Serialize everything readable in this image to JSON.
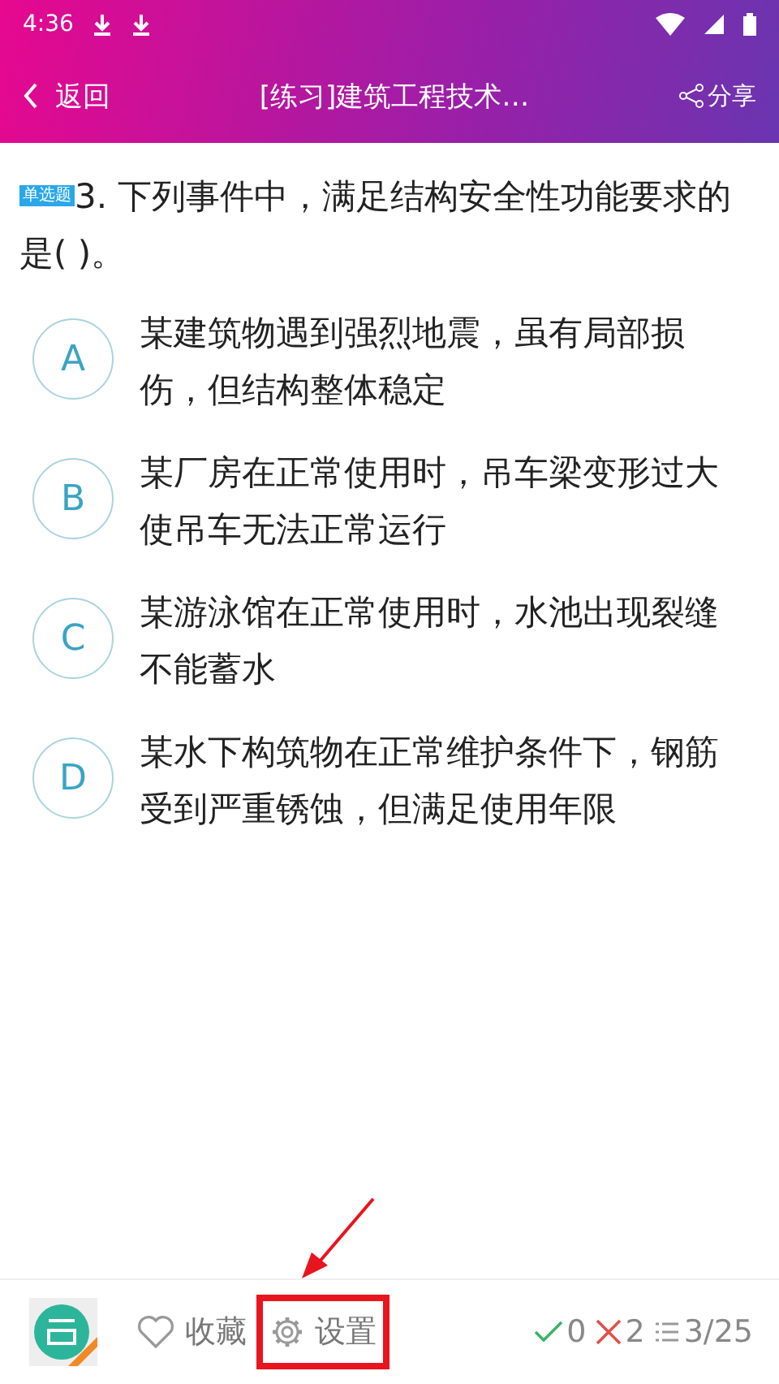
{
  "status_bar": {
    "time": "4:36"
  },
  "app_bar": {
    "back": "返回",
    "title": "[练习]建筑工程技术…",
    "share": "分享"
  },
  "question": {
    "type_badge": "单选题",
    "text": "3. 下列事件中，满足结构安全性功能要求的是( )。"
  },
  "options": [
    {
      "letter": "A",
      "text": "某建筑物遇到强烈地震，虽有局部损伤，但结构整体稳定"
    },
    {
      "letter": "B",
      "text": "某厂房在正常使用时，吊车梁变形过大使吊车无法正常运行"
    },
    {
      "letter": "C",
      "text": "某游泳馆在正常使用时，水池出现裂缝不能蓄水"
    },
    {
      "letter": "D",
      "text": "某水下构筑物在正常维护条件下，钢筋受到严重锈蚀，但满足使用年限"
    }
  ],
  "bottom_bar": {
    "favorite": "收藏",
    "settings": "设置",
    "settings_highlighted": true,
    "correct": "0",
    "wrong": "2",
    "progress": "3/25"
  }
}
